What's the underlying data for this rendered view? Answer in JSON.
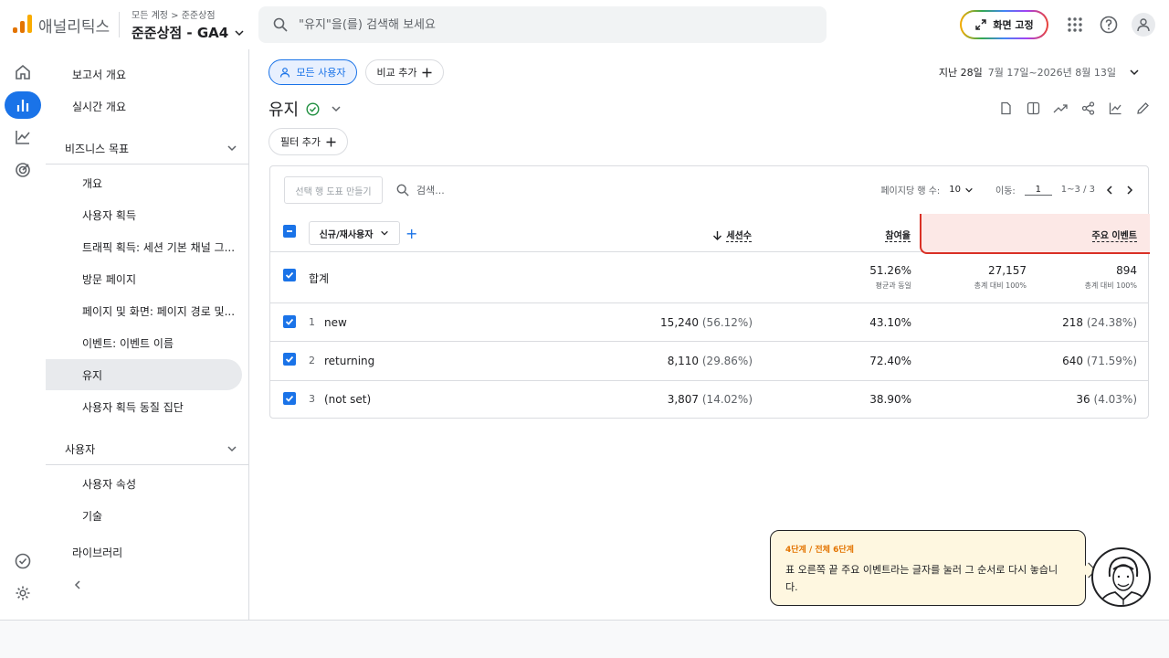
{
  "colors": {
    "accent": "#1a73e8",
    "logo": [
      "#f9ab00",
      "#e37400",
      "#e37400"
    ],
    "highlight": "#d93025"
  },
  "app": {
    "name": "애널리틱스",
    "breadcrumb": "모든 계정 > 준준상점",
    "property": "준준상점 - GA4"
  },
  "search": {
    "placeholder": "\"유지\"을(를) 검색해 보세요"
  },
  "topbar": {
    "pin_label": "화면 고정",
    "icons": [
      "apps-icon",
      "help-icon",
      "account-icon"
    ]
  },
  "rail": {
    "icons": [
      "home-icon",
      "reports-icon",
      "explore-icon",
      "advertising-icon",
      "check-icon",
      "settings-icon"
    ]
  },
  "sidenav": {
    "overview": "보고서 개요",
    "realtime": "실시간 개요",
    "business": "비즈니스 목표",
    "business_items": [
      "개요",
      "사용자 획득",
      "트래픽 획득: 세션 기본 채널 그...",
      "방문 페이지",
      "페이지 및 화면: 페이지 경로 및...",
      "이벤트: 이벤트 이름",
      "유지",
      "사용자 획득 동질 집단"
    ],
    "user": "사용자",
    "user_items": [
      "사용자 속성",
      "기술"
    ],
    "library": "라이브러리"
  },
  "main": {
    "all_users": "모든 사용자",
    "compare": "비교 추가",
    "date_prefix": "지난 28일",
    "date_range": "7월 17일~2026년 8월 13일",
    "title": "유지",
    "filter": "필터 추가"
  },
  "table": {
    "make_chart": "선택 행 도표 만들기",
    "search_placeholder": "검색...",
    "rows_per_page_label": "페이지당 행 수:",
    "rows_per_page": "10",
    "goto_label": "이동:",
    "goto_value": "1",
    "range": "1~3 / 3",
    "dimension": "신규/재사용자",
    "columns": [
      "세션수",
      "참여율",
      "주요 이벤트"
    ],
    "total": {
      "label": "합계",
      "sessions": "27,157",
      "sessions_sub": "총계 대비 100%",
      "engagement": "51.26%",
      "engagement_sub": "평균과 동일",
      "events": "894",
      "events_sub": "총계 대비 100%"
    },
    "rows": [
      {
        "idx": "1",
        "label": "new",
        "sessions": "15,240",
        "sessions_pct": "(56.12%)",
        "engagement": "43.10%",
        "events": "218",
        "events_pct": "(24.38%)"
      },
      {
        "idx": "2",
        "label": "returning",
        "sessions": "8,110",
        "sessions_pct": "(29.86%)",
        "engagement": "72.40%",
        "events": "640",
        "events_pct": "(71.59%)"
      },
      {
        "idx": "3",
        "label": "(not set)",
        "sessions": "3,807",
        "sessions_pct": "(14.02%)",
        "engagement": "38.90%",
        "events": "36",
        "events_pct": "(4.03%)"
      }
    ]
  },
  "tooltip": {
    "step": "4단계 / 전체 6단계",
    "text": "표 오른쪽 끝 주요 이벤트라는 글자를 눌러 그 순서로 다시 놓습니다."
  }
}
